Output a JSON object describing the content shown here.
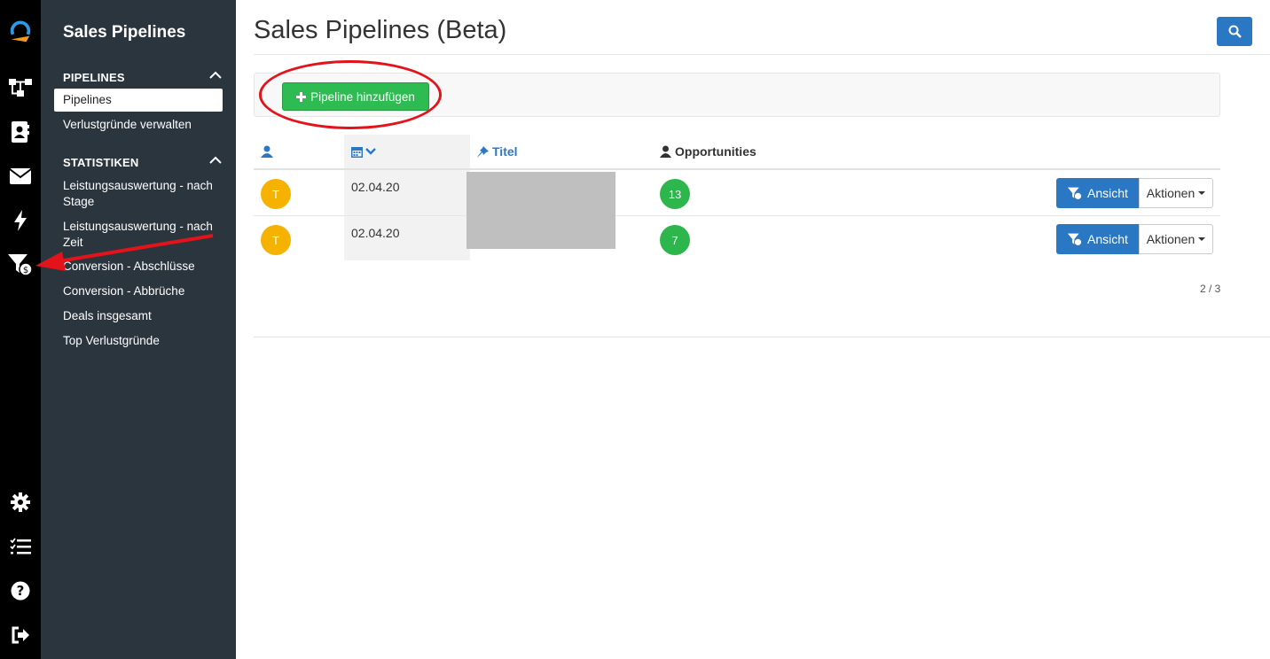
{
  "sidebar": {
    "title": "Sales Pipelines",
    "sections": [
      {
        "label": "PIPELINES",
        "items": [
          "Pipelines",
          "Verlustgründe verwalten"
        ]
      },
      {
        "label": "STATISTIKEN",
        "items": [
          "Leistungsauswertung - nach Stage",
          "Leistungsauswertung - nach Zeit",
          "Conversion - Abschlüsse",
          "Conversion - Abbrüche",
          "Deals insgesamt",
          "Top Verlustgründe"
        ]
      }
    ],
    "active_item": "Pipelines"
  },
  "rail_icons": [
    "logo-icon",
    "org-chart-icon",
    "contacts-icon",
    "mail-icon",
    "bolt-icon",
    "sales-funnel-icon",
    "settings-icon",
    "tasks-icon",
    "help-icon",
    "logout-icon"
  ],
  "main": {
    "title": "Sales Pipelines (Beta)",
    "add_button": "Pipeline hinzufügen",
    "table": {
      "headers": {
        "title": "Titel",
        "opportunities": "Opportunities"
      },
      "rows": [
        {
          "avatar": "T",
          "date": "02.04.20",
          "opportunities": "13",
          "view": "Ansicht",
          "actions": "Aktionen"
        },
        {
          "avatar": "T",
          "date": "02.04.20",
          "opportunities": "7",
          "view": "Ansicht",
          "actions": "Aktionen"
        }
      ]
    },
    "pager": "2 / 3"
  },
  "colors": {
    "rail": "#000000",
    "sidebar": "#2b353d",
    "primary": "#2a78c4",
    "success": "#2dbb52",
    "avatar": "#f6b200",
    "annotation": "#e3131b"
  }
}
